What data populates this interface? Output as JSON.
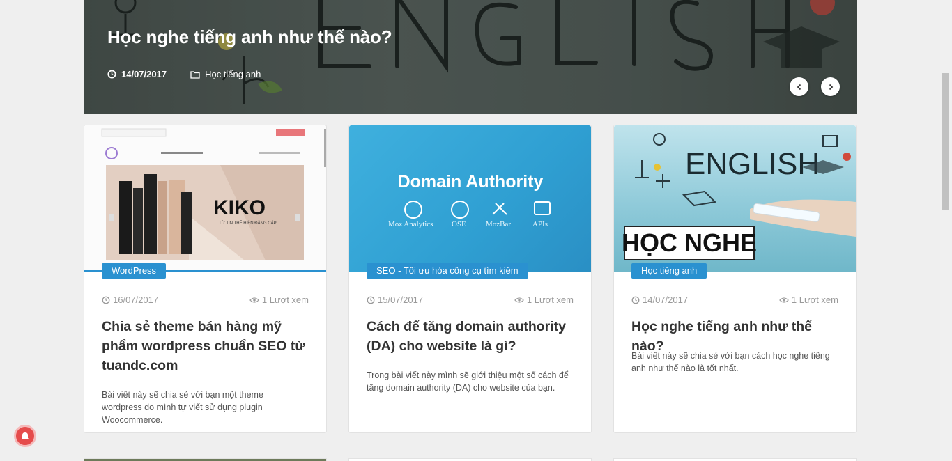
{
  "hero": {
    "title": "Học nghe tiếng anh như thế nào?",
    "date": "14/07/2017",
    "category": "Học tiếng anh",
    "prev_icon": "chevron-left-icon",
    "next_icon": "chevron-right-icon"
  },
  "posts": [
    {
      "category": "WordPress",
      "date": "16/07/2017",
      "views": "1 Lượt xem",
      "title": "Chia sẻ theme bán hàng mỹ phẩm wordpress chuẩn SEO từ tuandc.com",
      "excerpt": "Bài viết này sẽ chia sẻ với bạn một theme wordpress do mình tự viết sử dụng plugin Woocommerce.",
      "thumb_text": "KIKO",
      "thumb_subtext": "TỪ TIN THỂ HIỆN ĐẲNG CẤP"
    },
    {
      "category": "SEO - Tối ưu hóa công cụ tìm kiếm",
      "date": "15/07/2017",
      "views": "1 Lượt xem",
      "title": "Cách để tăng domain authority (DA) cho website là gì?",
      "excerpt": "Trong bài viết này mình sẽ giới thiệu một số cách để tăng domain authority (DA) cho website của bạn.",
      "thumb_text": "Domain Authority",
      "thumb_labels": [
        "Moz Analytics",
        "OSE",
        "MozBar",
        "APIs"
      ]
    },
    {
      "category": "Học tiếng anh",
      "date": "14/07/2017",
      "views": "1 Lượt xem",
      "title": "Học nghe tiếng anh như thế nào?",
      "excerpt": "Bài viết này sẽ chia sẻ với bạn cách học nghe tiếng anh như thế nào là tốt nhất.",
      "thumb_text": "ENGLISH",
      "thumb_subtext": "HỌC NGHE"
    }
  ],
  "colors": {
    "accent": "#2a91d0",
    "title": "#333333",
    "meta": "#9a9a9a",
    "notification": "#e54b4b"
  }
}
